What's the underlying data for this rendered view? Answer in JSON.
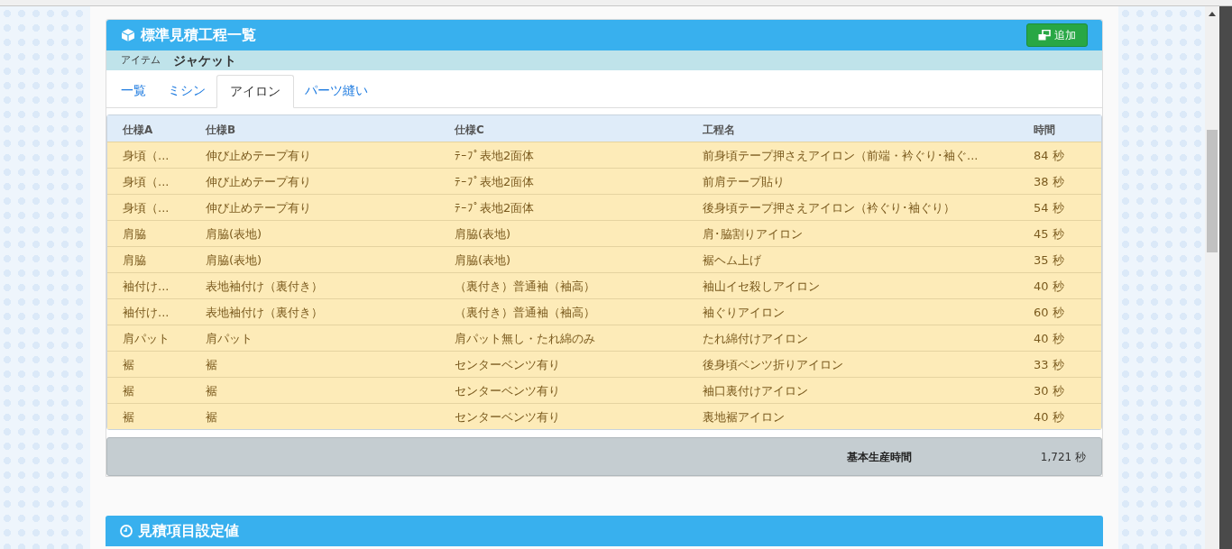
{
  "panel": {
    "title": "標準見積工程一覧",
    "add_button": "追加",
    "item_label": "アイテム",
    "item_value": "ジャケット"
  },
  "tabs": [
    {
      "label": "一覧",
      "selected": false
    },
    {
      "label": "ミシン",
      "selected": false
    },
    {
      "label": "アイロン",
      "selected": true
    },
    {
      "label": "パーツ縫い",
      "selected": false
    }
  ],
  "table": {
    "columns": [
      "仕様A",
      "仕様B",
      "仕様C",
      "工程名",
      "時間"
    ],
    "rows": [
      [
        "身頃（...",
        "伸び止めテープ有り",
        "ﾃｰﾌﾟ表地2面体",
        "前身頃テープ押さえアイロン（前端・衿ぐり･袖ぐ...",
        "84 秒"
      ],
      [
        "身頃（...",
        "伸び止めテープ有り",
        "ﾃｰﾌﾟ表地2面体",
        "前肩テープ貼り",
        "38 秒"
      ],
      [
        "身頃（...",
        "伸び止めテープ有り",
        "ﾃｰﾌﾟ表地2面体",
        "後身頃テープ押さえアイロン（衿ぐり･袖ぐり）",
        "54 秒"
      ],
      [
        "肩脇",
        "肩脇(表地)",
        "肩脇(表地)",
        "肩･脇割りアイロン",
        "45 秒"
      ],
      [
        "肩脇",
        "肩脇(表地)",
        "肩脇(表地)",
        "裾ヘム上げ",
        "35 秒"
      ],
      [
        "袖付け...",
        "表地袖付け（裏付き）",
        "（裏付き）普通袖（袖高）",
        "袖山イセ殺しアイロン",
        "40 秒"
      ],
      [
        "袖付け...",
        "表地袖付け（裏付き）",
        "（裏付き）普通袖（袖高）",
        "袖ぐりアイロン",
        "60 秒"
      ],
      [
        "肩パット",
        "肩パット",
        "肩パット無し・たれ綿のみ",
        "たれ綿付けアイロン",
        "40 秒"
      ],
      [
        "裾",
        "裾",
        "センターベンツ有り",
        "後身頃ベンツ折りアイロン",
        "33 秒"
      ],
      [
        "裾",
        "裾",
        "センターベンツ有り",
        "袖口裏付けアイロン",
        "30 秒"
      ],
      [
        "裾",
        "裾",
        "センターベンツ有り",
        "裏地裾アイロン",
        "40 秒"
      ]
    ]
  },
  "footer": {
    "label": "基本生産時間",
    "value": "1,721 秒"
  },
  "second_panel": {
    "title": "見積項目設定値"
  }
}
